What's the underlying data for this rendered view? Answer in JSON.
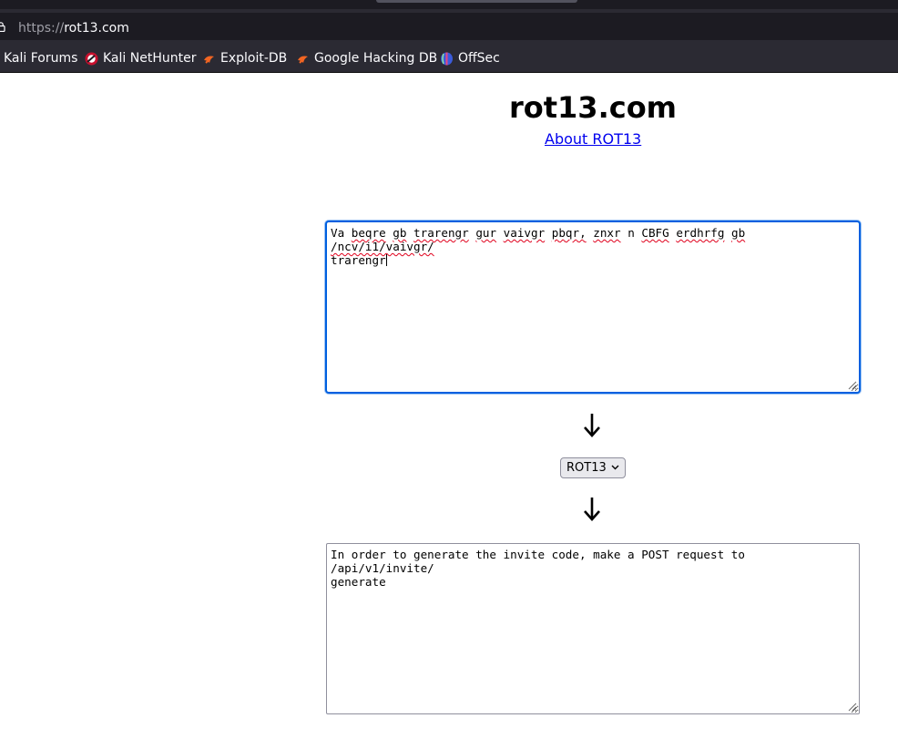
{
  "browser": {
    "url_scheme": "https://",
    "url_host": "rot13.com",
    "bookmarks": [
      {
        "label": "Kali Forums",
        "icon": "kali-dragon-icon"
      },
      {
        "label": "Kali NetHunter",
        "icon": "nethunter-icon"
      },
      {
        "label": "Exploit-DB",
        "icon": "exploit-db-icon"
      },
      {
        "label": "Google Hacking DB",
        "icon": "exploit-db-icon"
      },
      {
        "label": "OffSec",
        "icon": "offsec-icon"
      }
    ]
  },
  "page": {
    "title": "rot13.com",
    "about_link": "About ROT13"
  },
  "converter": {
    "input_words": [
      "Va",
      "beqre",
      "gb",
      "trarengr",
      "gur",
      "vaivgr",
      "pbqr,",
      "znxr",
      "n",
      "CBFG",
      "erdhrfg",
      "gb",
      "/ncv/i1/vaivgr/",
      "trarengr"
    ],
    "cipher_selected": "ROT13",
    "output_text": "In order to generate the invite code, make a POST request to /api/v1/invite/\ngenerate"
  },
  "colors": {
    "focus_ring": "#0060df",
    "link": "#0000ee",
    "chrome_bg": "#2b2a33",
    "spellcheck": "#e0001b"
  }
}
